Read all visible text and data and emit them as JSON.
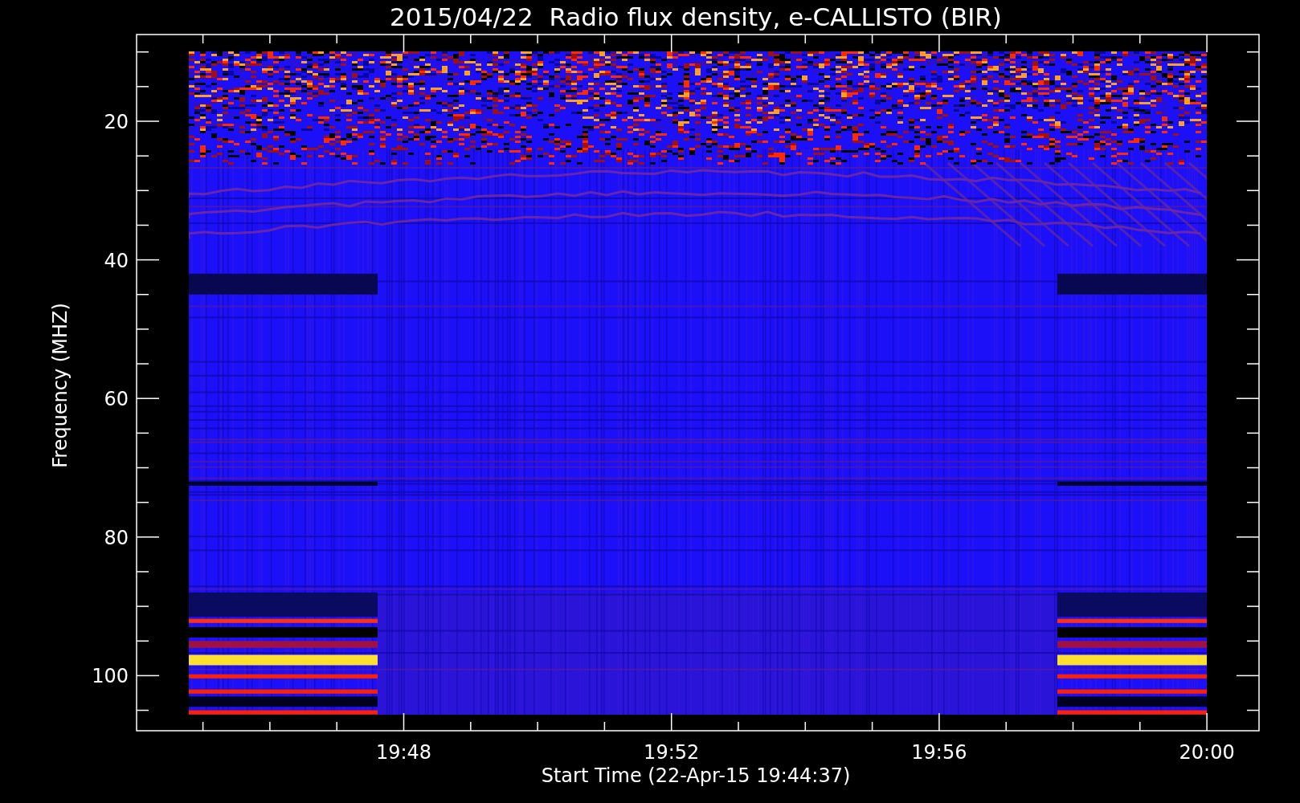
{
  "title": "2015/04/22  Radio flux density, e-CALLISTO (BIR)",
  "y_axis": {
    "label": "Frequency (MHZ)",
    "ticks": [
      "20",
      "40",
      "60",
      "80",
      "100"
    ]
  },
  "x_axis": {
    "label": "Start Time (22-Apr-15 19:44:37)",
    "ticks": [
      "19:48",
      "19:52",
      "19:56",
      "20:00"
    ]
  }
}
